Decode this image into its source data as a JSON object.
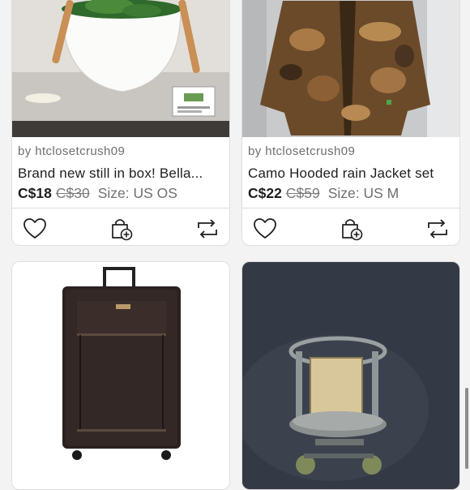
{
  "listings": [
    {
      "seller": "by htclosetcrush09",
      "title": "Brand new still in box! Bella...",
      "price": "C$18",
      "original_price": "C$30",
      "size": "Size: US OS",
      "image": "white-bowl-salad-server-box"
    },
    {
      "seller": "by htclosetcrush09",
      "title": "Camo Hooded rain Jacket set",
      "price": "C$22",
      "original_price": "C$59",
      "size": "Size: US M",
      "image": "camo-rain-jacket"
    },
    {
      "image": "black-rolling-suitcase"
    },
    {
      "image": "vintage-fishing-reel"
    }
  ],
  "icons": [
    "heart-icon",
    "bundle-add-icon",
    "share-repost-icon"
  ]
}
